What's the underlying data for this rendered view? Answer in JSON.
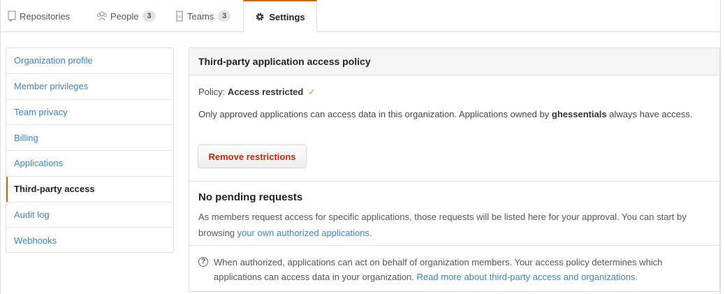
{
  "tabs": {
    "repositories": {
      "label": "Repositories",
      "icon": "repo-icon"
    },
    "people": {
      "label": "People",
      "count": "3",
      "icon": "organization-icon"
    },
    "teams": {
      "label": "Teams",
      "count": "3",
      "icon": "jersey-icon"
    },
    "settings": {
      "label": "Settings",
      "icon": "gear-icon"
    }
  },
  "sidebar": {
    "items": [
      {
        "label": "Organization profile"
      },
      {
        "label": "Member privileges"
      },
      {
        "label": "Team privacy"
      },
      {
        "label": "Billing"
      },
      {
        "label": "Applications"
      },
      {
        "label": "Third-party access",
        "active": true
      },
      {
        "label": "Audit log"
      },
      {
        "label": "Webhooks"
      }
    ]
  },
  "panel": {
    "title": "Third-party application access policy",
    "policy_prefix": "Policy:",
    "policy_value": "Access restricted",
    "policy_check": "✓",
    "desc_before": "Only approved applications can access data in this organization. Applications owned by",
    "desc_org": "ghessentials",
    "desc_after": "always have access.",
    "button_label": "Remove restrictions",
    "pending_title": "No pending requests",
    "pending_text": "As members request access for specific applications, those requests will be listed here for your approval. You can start by browsing",
    "pending_link": "your own authorized applications",
    "pending_end": ".",
    "help_text": "When authorized, applications can act on behalf of organization members. Your access policy determines which applications can access data in your organization.",
    "help_link": "Read more about third-party access and organizations."
  },
  "colors": {
    "accent": "#d26911",
    "link": "#4183c4",
    "danger": "#bd2c00",
    "success": "#6cc644"
  }
}
